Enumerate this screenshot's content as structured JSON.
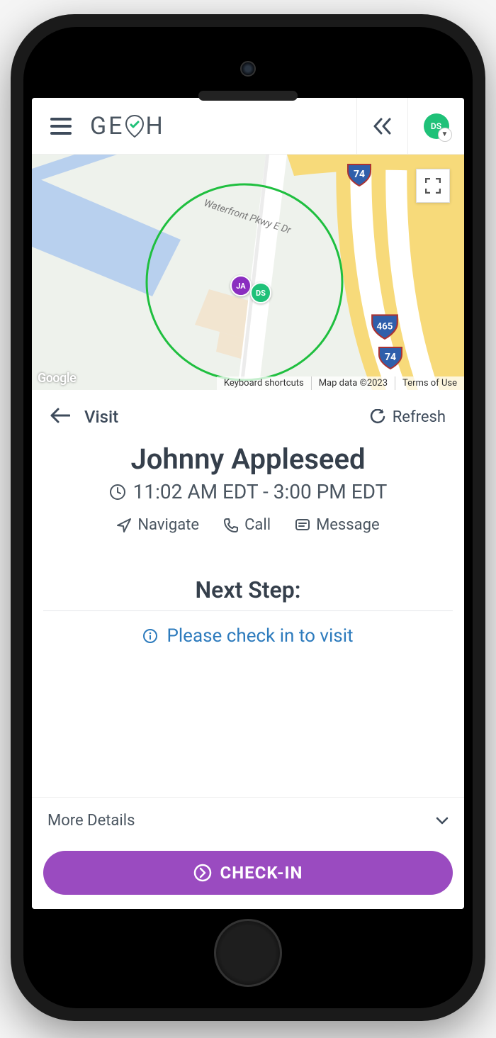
{
  "header": {
    "logo_text_left": "GE",
    "logo_text_right": "H",
    "avatar_initials": "DS"
  },
  "map": {
    "street_label": "Waterfront Pkwy E Dr",
    "google_logo": "Google",
    "attrib_shortcuts": "Keyboard shortcuts",
    "attrib_data": "Map data ©2023",
    "attrib_terms": "Terms of Use",
    "pins": {
      "ja": "JA",
      "ds": "DS"
    },
    "shields": [
      "74",
      "465",
      "74"
    ]
  },
  "visit": {
    "back_label": "Visit",
    "refresh_label": "Refresh",
    "patient_name": "Johnny Appleseed",
    "time_range": "11:02 AM EDT - 3:00 PM EDT",
    "actions": {
      "navigate": "Navigate",
      "call": "Call",
      "message": "Message"
    },
    "next_step_title": "Next Step:",
    "next_step_message": "Please check in to visit",
    "more_details_label": "More Details",
    "checkin_button": "CHECK-IN"
  }
}
